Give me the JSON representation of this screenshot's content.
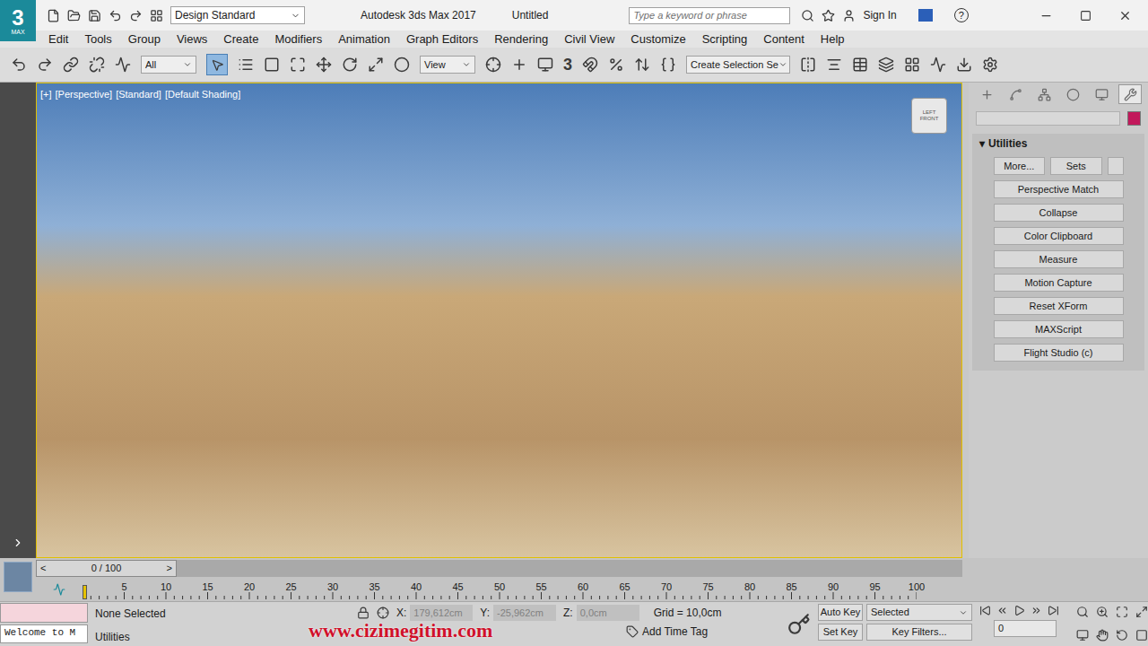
{
  "app": {
    "logo": "3",
    "logo_sub": "MAX",
    "title": "Autodesk 3ds Max 2017",
    "document": "Untitled",
    "workspace": "Design Standard",
    "search_placeholder": "Type a keyword or phrase",
    "sign_in": "Sign In",
    "help": "?"
  },
  "menu": [
    "Edit",
    "Tools",
    "Group",
    "Views",
    "Create",
    "Modifiers",
    "Animation",
    "Graph Editors",
    "Rendering",
    "Civil View",
    "Customize",
    "Scripting",
    "Content",
    "Help"
  ],
  "toolbar": {
    "filter": "All",
    "ref_coord": "View",
    "snap_label": "3",
    "selection_set": "Create Selection Se"
  },
  "viewport": {
    "labels": [
      "[+]",
      "[Perspective]",
      "[Standard]",
      "[Default Shading]"
    ],
    "viewcube": [
      "LEFT",
      "FRONT"
    ]
  },
  "command_panel": {
    "tabs": [
      {
        "name": "create",
        "selected": false
      },
      {
        "name": "modify",
        "selected": false
      },
      {
        "name": "hierarchy",
        "selected": false
      },
      {
        "name": "motion",
        "selected": false
      },
      {
        "name": "display",
        "selected": false
      },
      {
        "name": "utilities",
        "selected": true
      }
    ],
    "swatch_color": "#c2185b",
    "rollout": {
      "title": "Utilities",
      "expanded": true,
      "toggle": "▾"
    },
    "top_buttons": [
      "More...",
      "Sets"
    ],
    "utilities": [
      "Perspective Match",
      "Collapse",
      "Color Clipboard",
      "Measure",
      "Motion Capture",
      "Reset XForm",
      "MAXScript",
      "Flight Studio (c)"
    ]
  },
  "time_slider": {
    "prev": "<",
    "frame": "0 / 100",
    "next": ">",
    "level": 0
  },
  "track": {
    "ticks": [
      "5",
      "10",
      "15",
      "20",
      "25",
      "30",
      "35",
      "40",
      "45",
      "50",
      "55",
      "60",
      "65",
      "70",
      "75",
      "80",
      "85",
      "90",
      "95",
      "100"
    ]
  },
  "status": {
    "listener": "Welcome to M",
    "selection": "None Selected",
    "prompt": "Utilities",
    "coords": [
      {
        "label": "X:",
        "value": "179,612cm"
      },
      {
        "label": "Y:",
        "value": "-25,962cm"
      },
      {
        "label": "Z:",
        "value": "0,0cm"
      }
    ],
    "grid": "Grid = 10,0cm",
    "time_tag": "Add Time Tag",
    "auto_key": "Auto Key",
    "key_mode": "Selected",
    "set_key": "Set Key",
    "key_filters": "Key Filters...",
    "frame": "0"
  },
  "watermark": "www.cizimegitim.com"
}
